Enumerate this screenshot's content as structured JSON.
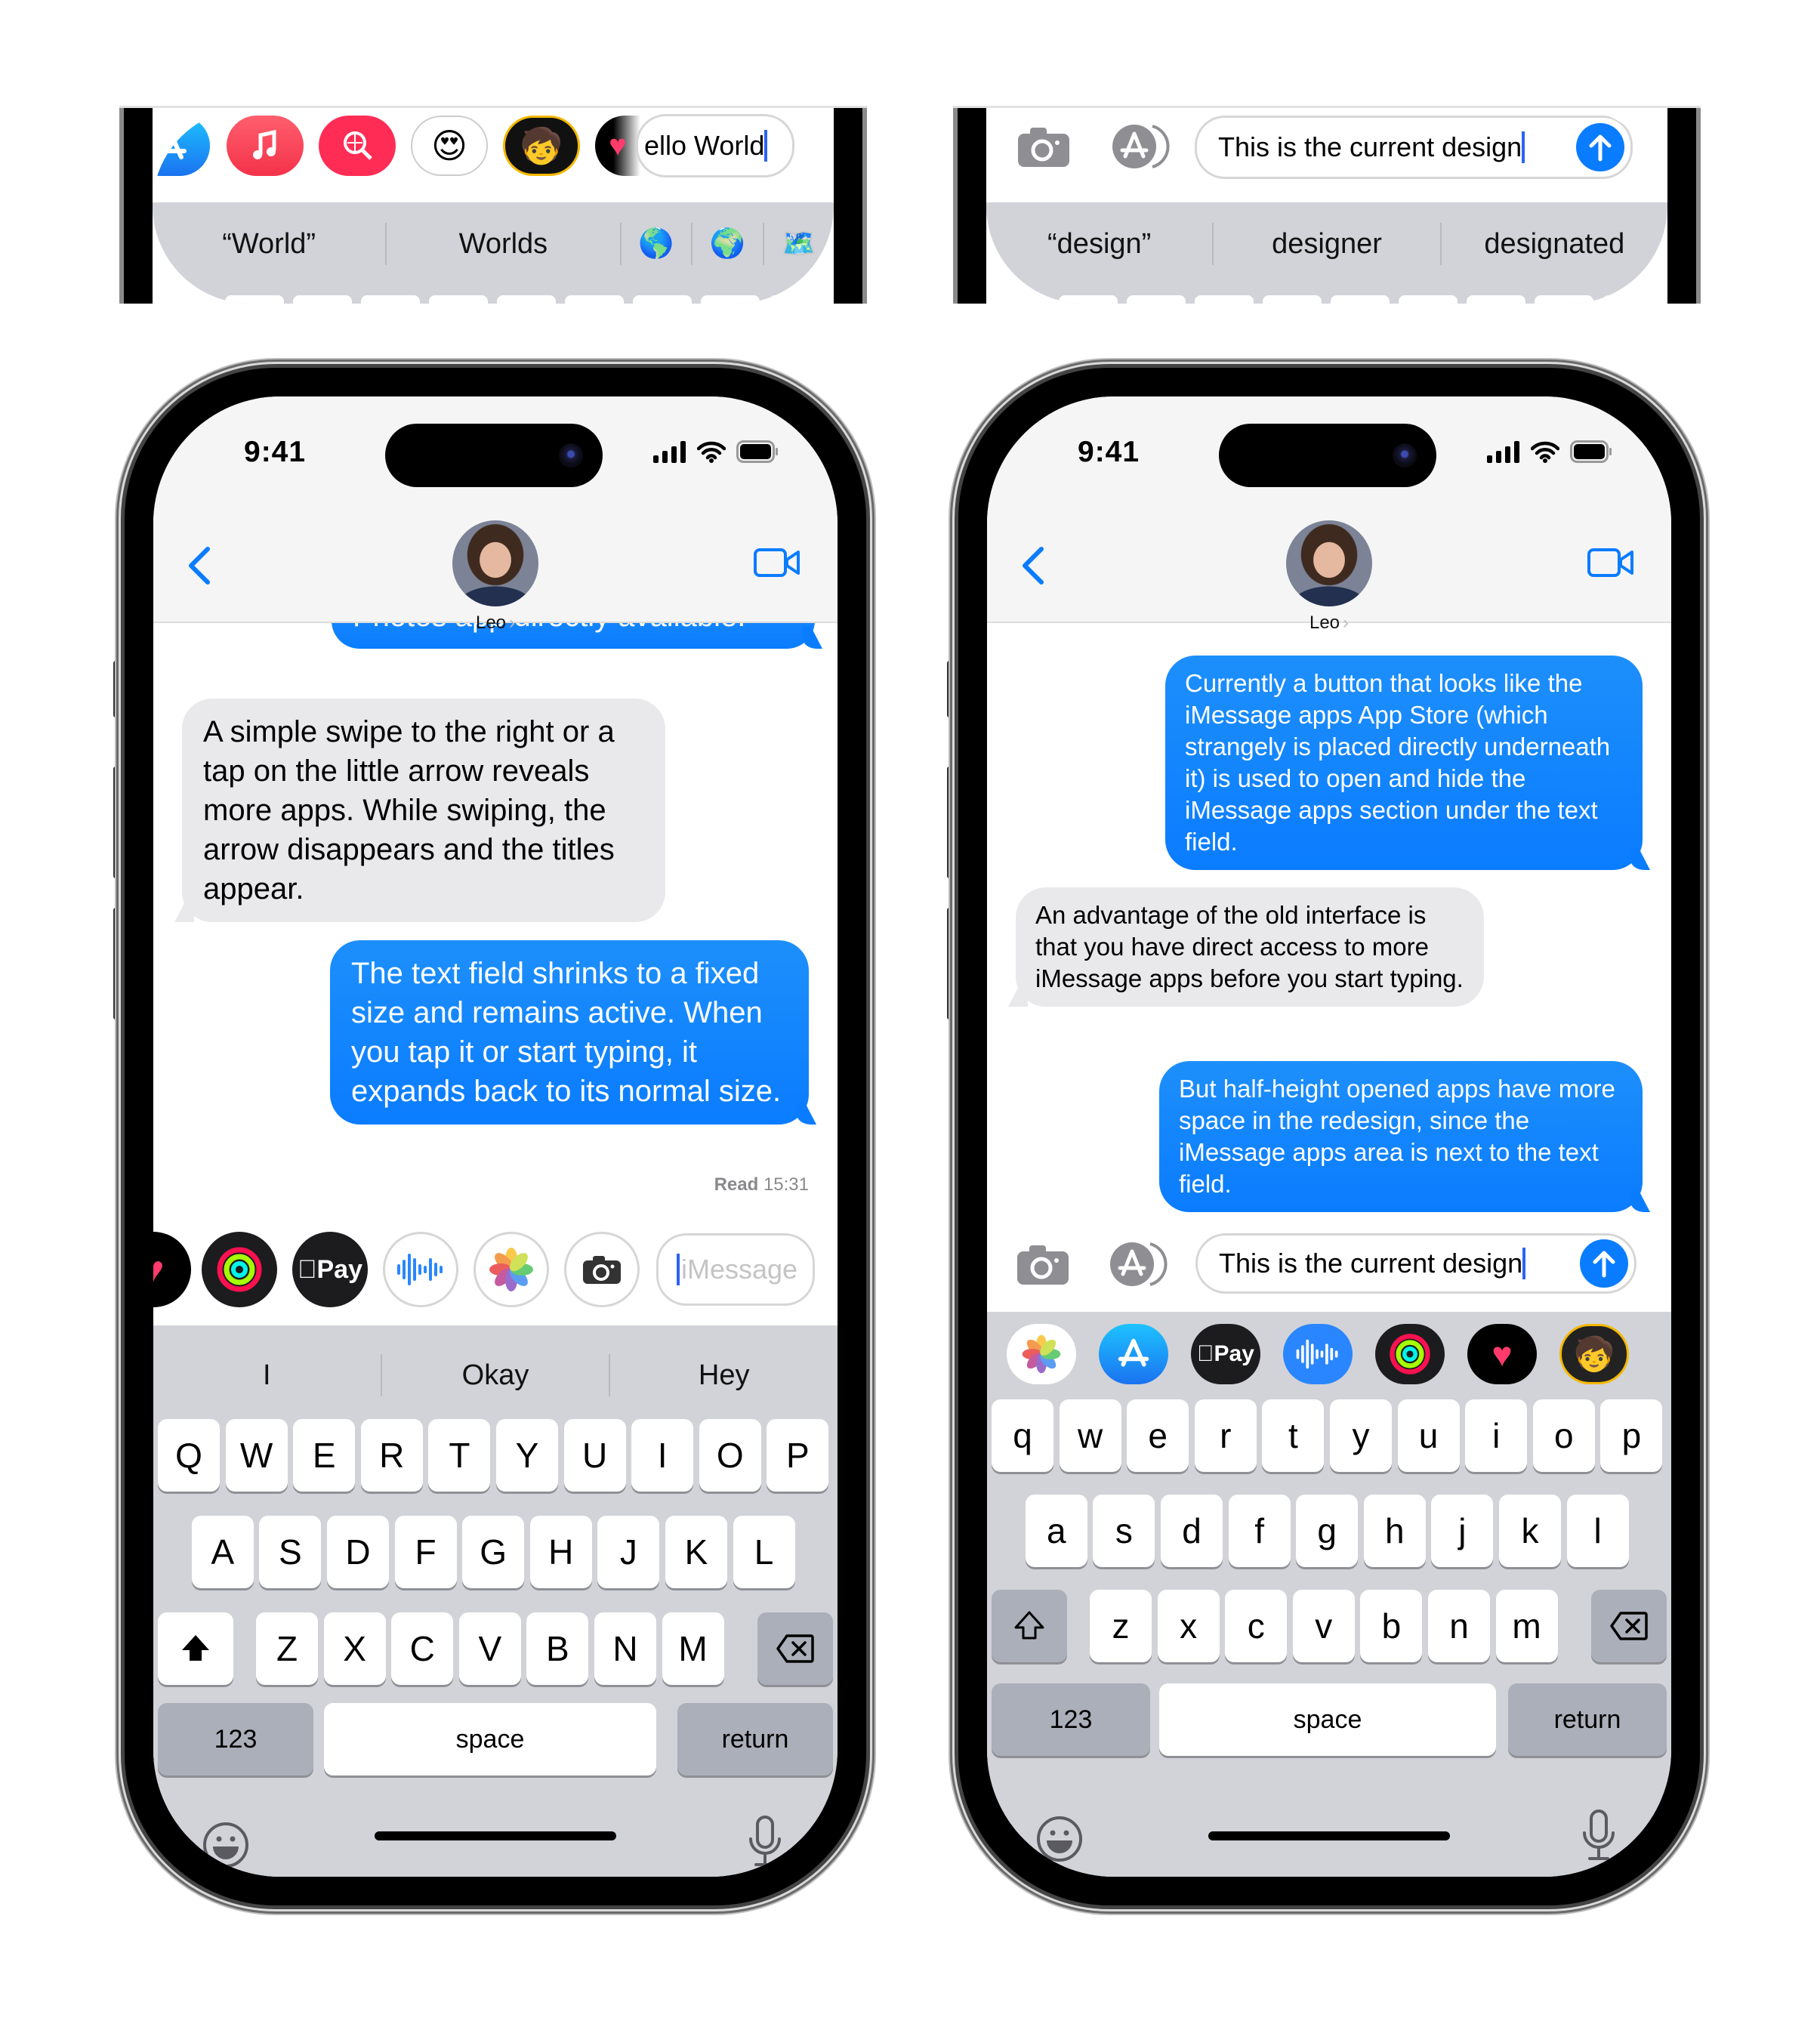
{
  "colors": {
    "accent": "#0a7cff",
    "incoming_bubble": "#e9e9eb",
    "keyboard_bg": "#d2d3d8",
    "dark_key": "#abafba"
  },
  "crops": [
    {
      "id": "left",
      "apps": [
        "app-store",
        "apple-music",
        "image-search",
        "memoji-stickers",
        "memoji-camera",
        "digital-touch"
      ],
      "field_text": "Hello World",
      "field_text_visible": "ello World",
      "suggestions": [
        "“World”",
        "Worlds"
      ],
      "emoji_suggestions": [
        "🌎",
        "🌍",
        "🗺️"
      ]
    },
    {
      "id": "right",
      "field_text": "This is the current design",
      "suggestions": [
        "“design”",
        "designer",
        "designated"
      ]
    }
  ],
  "phones": [
    {
      "id": "old-design",
      "status": {
        "time": "9:41"
      },
      "contact": {
        "name": "Leo",
        "chevron": "›"
      },
      "messages": [
        {
          "dir": "out",
          "text": "Photos app directly available.",
          "clipped": true
        },
        {
          "dir": "in",
          "text": "A simple swipe to the right or a tap on the little arrow reveals more apps. While swiping, the arrow disappears and the titles appear."
        },
        {
          "dir": "out",
          "text": "The text field shrinks to a fixed size and remains active. When you tap it or start typing, it expands back to its normal size."
        }
      ],
      "receipt": {
        "label": "Read",
        "time": "15:31"
      },
      "app_strip": [
        "digital-touch",
        "activity",
        "apple-pay",
        "audio",
        "photos",
        "camera"
      ],
      "apple_pay_label": "Pay",
      "input": {
        "placeholder": "iMessage",
        "value": ""
      },
      "suggestions": [
        "I",
        "Okay",
        "Hey"
      ],
      "keyboard": {
        "rows": [
          [
            "Q",
            "W",
            "E",
            "R",
            "T",
            "Y",
            "U",
            "I",
            "O",
            "P"
          ],
          [
            "A",
            "S",
            "D",
            "F",
            "G",
            "H",
            "J",
            "K",
            "L"
          ],
          [
            "Z",
            "X",
            "C",
            "V",
            "B",
            "N",
            "M"
          ]
        ],
        "numbers": "123",
        "space": "space",
        "return": "return",
        "shift_active": true
      }
    },
    {
      "id": "current-design",
      "status": {
        "time": "9:41"
      },
      "contact": {
        "name": "Leo",
        "chevron": "›"
      },
      "messages": [
        {
          "dir": "out",
          "text": "Currently a button that looks like the iMessage apps App Store (which strangely is placed directly underneath it) is used to open and hide the iMessage apps section under the text field."
        },
        {
          "dir": "in",
          "text": "An advantage of the old interface is that you have direct access to more iMessage apps before you start typing."
        },
        {
          "dir": "out",
          "text": "But half-height opened apps have more space in the redesign, since the iMessage apps area is next to the text field."
        }
      ],
      "input": {
        "value": "This is the current design"
      },
      "app_strip": [
        "photos",
        "app-store",
        "apple-pay",
        "audio",
        "activity",
        "digital-touch",
        "memoji-camera"
      ],
      "apple_pay_label": "Pay",
      "keyboard": {
        "rows": [
          [
            "q",
            "w",
            "e",
            "r",
            "t",
            "y",
            "u",
            "i",
            "o",
            "p"
          ],
          [
            "a",
            "s",
            "d",
            "f",
            "g",
            "h",
            "j",
            "k",
            "l"
          ],
          [
            "z",
            "x",
            "c",
            "v",
            "b",
            "n",
            "m"
          ]
        ],
        "numbers": "123",
        "space": "space",
        "return": "return",
        "shift_active": false
      }
    }
  ]
}
